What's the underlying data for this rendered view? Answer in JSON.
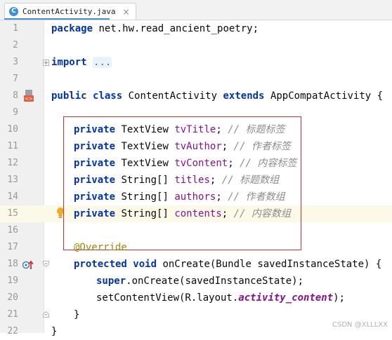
{
  "tab": {
    "file_name": "ContentActivity.java",
    "file_type_icon": "C"
  },
  "lines": [
    {
      "n": "1"
    },
    {
      "n": "2"
    },
    {
      "n": "3"
    },
    {
      "n": "7"
    },
    {
      "n": "8"
    },
    {
      "n": "9"
    },
    {
      "n": "10"
    },
    {
      "n": "11"
    },
    {
      "n": "12"
    },
    {
      "n": "13"
    },
    {
      "n": "14"
    },
    {
      "n": "15"
    },
    {
      "n": "16"
    },
    {
      "n": "17"
    },
    {
      "n": "18"
    },
    {
      "n": "19"
    },
    {
      "n": "20"
    },
    {
      "n": "21"
    },
    {
      "n": "22"
    }
  ],
  "code": {
    "l1": {
      "kw": "package",
      "text": " net.hw.read_ancient_poetry;"
    },
    "l3": {
      "kw": "import",
      "folded": "..."
    },
    "l8": {
      "kw1": "public",
      "kw2": "class",
      "name": "ContentActivity",
      "kw3": "extends",
      "parent": "AppCompatActivity {"
    },
    "l10": {
      "kw": "private",
      "type": "TextView",
      "field": "tvTitle",
      "semi": ";",
      "comment": "// 标题标签"
    },
    "l11": {
      "kw": "private",
      "type": "TextView",
      "field": "tvAuthor",
      "semi": ";",
      "comment": "// 作者标签"
    },
    "l12": {
      "kw": "private",
      "type": "TextView",
      "field": "tvContent",
      "semi": ";",
      "comment": "// 内容标签"
    },
    "l13": {
      "kw": "private",
      "type": "String[]",
      "field": "titles",
      "semi": ";",
      "comment": "// 标题数组"
    },
    "l14": {
      "kw": "private",
      "type": "String[]",
      "field": "authors",
      "semi": ";",
      "comment": "// 作者数组"
    },
    "l15": {
      "kw": "private",
      "type": "String[]",
      "field": "contents",
      "semi": ";",
      "comment": "// 内容数组"
    },
    "l17": {
      "annotation": "@Override"
    },
    "l18": {
      "kw1": "protected",
      "kw2": "void",
      "text": "onCreate(Bundle savedInstanceState) {"
    },
    "l19": {
      "kw": "super",
      "text": ".onCreate(savedInstanceState);"
    },
    "l20": {
      "pre": "setContentView(R.layout.",
      "field": "activity_content",
      "post": ");"
    },
    "l21": {
      "text": "}"
    },
    "l22": {
      "text": "}"
    }
  },
  "watermark": "CSDN @XLLLXX"
}
